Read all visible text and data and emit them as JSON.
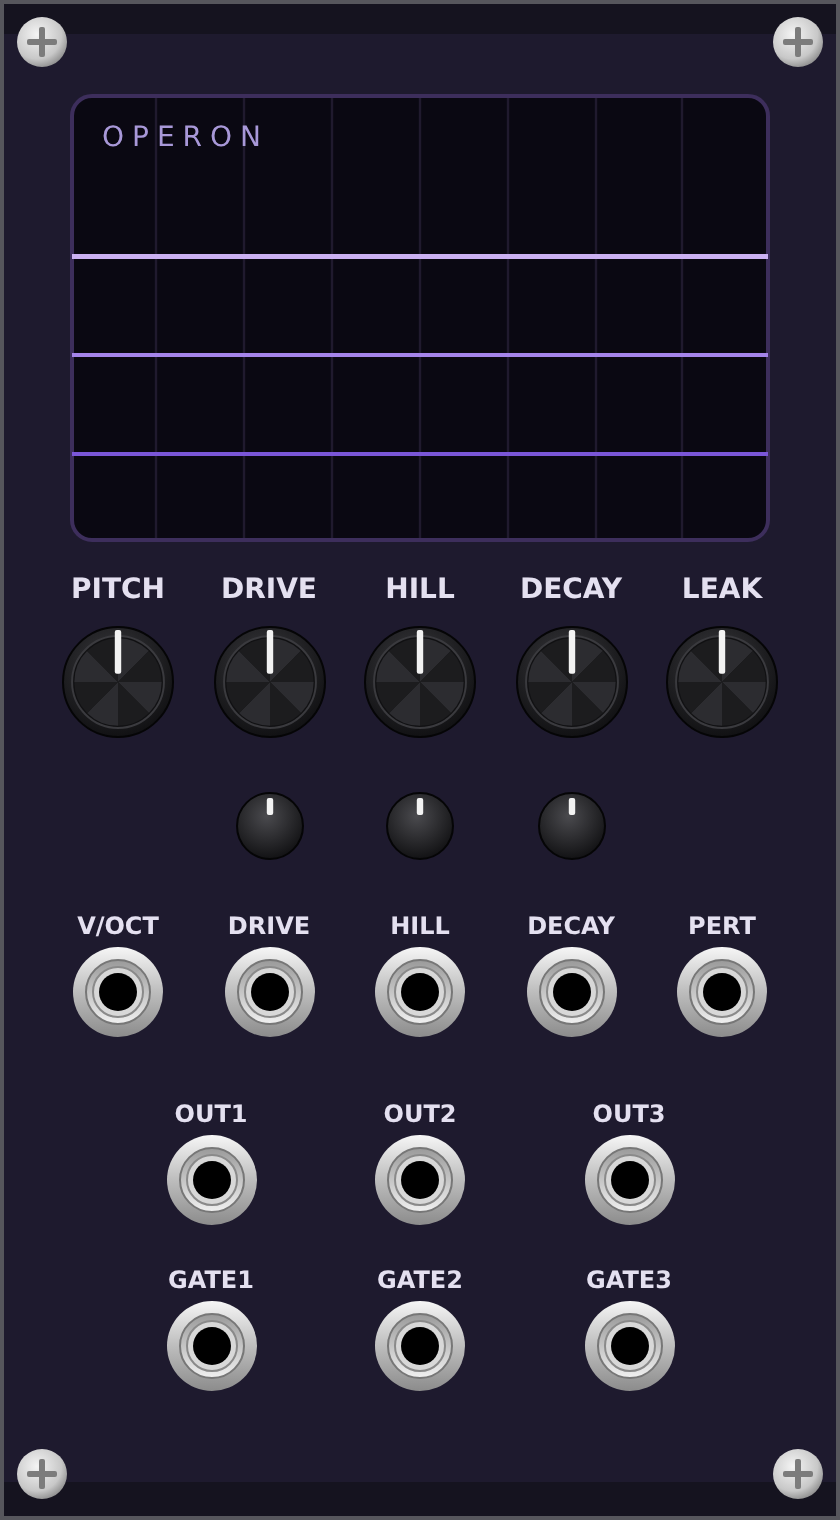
{
  "module": {
    "title": "OPERON"
  },
  "knobs": [
    {
      "label": "PITCH"
    },
    {
      "label": "DRIVE"
    },
    {
      "label": "HILL"
    },
    {
      "label": "DECAY"
    },
    {
      "label": "LEAK"
    }
  ],
  "inputs": [
    {
      "label": "V/OCT"
    },
    {
      "label": "DRIVE"
    },
    {
      "label": "HILL"
    },
    {
      "label": "DECAY"
    },
    {
      "label": "PERT"
    }
  ],
  "outputs": [
    {
      "label": "OUT1"
    },
    {
      "label": "OUT2"
    },
    {
      "label": "OUT3"
    }
  ],
  "gates": [
    {
      "label": "GATE1"
    },
    {
      "label": "GATE2"
    },
    {
      "label": "GATE3"
    }
  ]
}
